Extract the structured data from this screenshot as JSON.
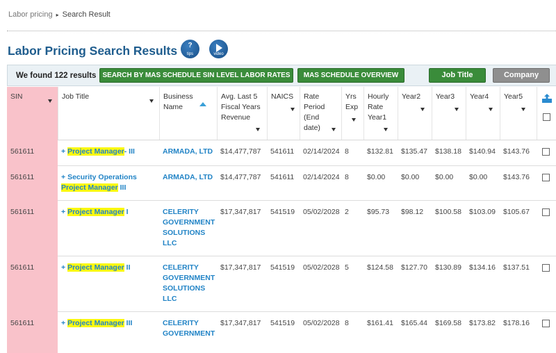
{
  "breadcrumb": {
    "parent": "Labor pricing",
    "separator": "▸",
    "current": "Search Result"
  },
  "page_title": "Labor Pricing Search Results",
  "help_buttons": {
    "tips": "tips",
    "video": "video"
  },
  "toolbar": {
    "found_text": "We found 122 results",
    "btn_sin": "SEARCH BY MAS SCHEDULE SIN LEVEL LABOR RATES",
    "btn_overview": "MAS SCHEDULE OVERVIEW",
    "btn_job": "Job Title",
    "btn_company": "Company"
  },
  "columns": [
    "SIN",
    "Job Title",
    "Business Name",
    "Avg. Last 5\nFiscal Years\nRevenue",
    "NAICS",
    "Rate\nPeriod\n(End date)",
    "Yrs\nExp",
    "Hourly\nRate\nYear1",
    "Year2",
    "Year3",
    "Year4",
    "Year5"
  ],
  "rows": [
    {
      "sin": "561611",
      "plus": "+ ",
      "pre": "",
      "hl": "Project Manager",
      "post": "- III",
      "biz": "ARMADA, LTD",
      "rev": "$14,477,787",
      "naics": "541611",
      "period": "02/14/2024",
      "exp": "8",
      "y1": "$132.81",
      "y2": "$135.47",
      "y3": "$138.18",
      "y4": "$140.94",
      "y5": "$143.76"
    },
    {
      "sin": "561611",
      "plus": "+ ",
      "pre": "Security Operations ",
      "hl": "Project Manager",
      "post": " III",
      "biz": "ARMADA, LTD",
      "rev": "$14,477,787",
      "naics": "541611",
      "period": "02/14/2024",
      "exp": "8",
      "y1": "$0.00",
      "y2": "$0.00",
      "y3": "$0.00",
      "y4": "$0.00",
      "y5": "$143.76"
    },
    {
      "sin": "561611",
      "plus": "+ ",
      "pre": "",
      "hl": "Project Manager",
      "post": " I",
      "biz": "CELERITY GOVERNMENT SOLUTIONS LLC",
      "rev": "$17,347,817",
      "naics": "541519",
      "period": "05/02/2028",
      "exp": "2",
      "y1": "$95.73",
      "y2": "$98.12",
      "y3": "$100.58",
      "y4": "$103.09",
      "y5": "$105.67"
    },
    {
      "sin": "561611",
      "plus": "+ ",
      "pre": "",
      "hl": "Project Manager",
      "post": " II",
      "biz": "CELERITY GOVERNMENT SOLUTIONS LLC",
      "rev": "$17,347,817",
      "naics": "541519",
      "period": "05/02/2028",
      "exp": "5",
      "y1": "$124.58",
      "y2": "$127.70",
      "y3": "$130.89",
      "y4": "$134.16",
      "y5": "$137.51"
    },
    {
      "sin": "561611",
      "plus": "+ ",
      "pre": "",
      "hl": "Project Manager",
      "post": " III",
      "biz": "CELERITY GOVERNMENT",
      "rev": "$17,347,817",
      "naics": "541519",
      "period": "05/02/2028",
      "exp": "8",
      "y1": "$161.41",
      "y2": "$165.44",
      "y3": "$169.58",
      "y4": "$173.82",
      "y5": "$178.16"
    }
  ],
  "colors": {
    "title": "#1f5d8e",
    "link": "#2284c6",
    "highlight": "#fbf80f",
    "sin_column": "#f9c2ca",
    "green_button": "#3a8c3a",
    "gray_button": "#8f8f8f"
  },
  "icons": {
    "export": "share-export-icon"
  }
}
